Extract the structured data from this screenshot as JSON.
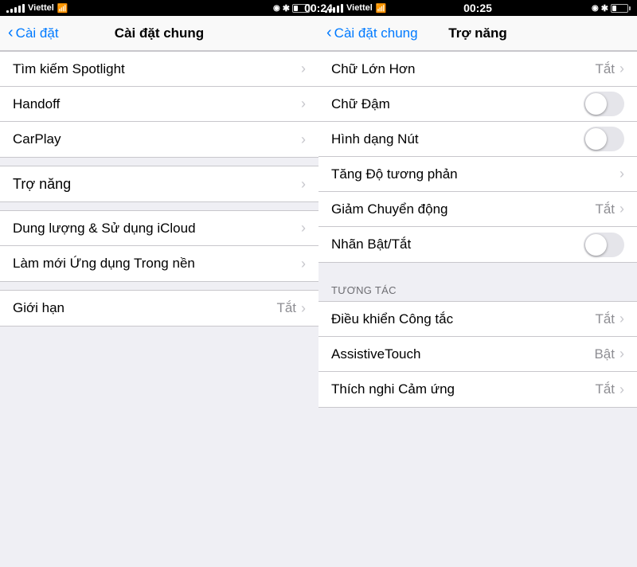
{
  "panel_left": {
    "status": {
      "carrier": "Viettel",
      "time": "00:24",
      "battery_pct": 30
    },
    "nav": {
      "back_label": "Cài đặt",
      "title": "Cài đặt chung"
    },
    "items": [
      {
        "label": "Tìm kiếm Spotlight",
        "value": "",
        "type": "chevron"
      },
      {
        "label": "Handoff",
        "value": "",
        "type": "chevron"
      },
      {
        "label": "CarPlay",
        "value": "",
        "type": "chevron"
      },
      {
        "label": "Trợ năng",
        "value": "",
        "type": "chevron",
        "highlighted": true
      },
      {
        "label": "Dung lượng & Sử dụng iCloud",
        "value": "",
        "type": "chevron"
      },
      {
        "label": "Làm mới Ứng dụng Trong nền",
        "value": "",
        "type": "chevron"
      },
      {
        "label": "Giới hạn",
        "value": "Tắt",
        "type": "chevron"
      }
    ]
  },
  "panel_right": {
    "status": {
      "carrier": "Viettel",
      "time": "00:25",
      "battery_pct": 30
    },
    "nav": {
      "back_label": "Cài đặt chung",
      "title": "Trợ năng"
    },
    "items_top": [
      {
        "label": "Chữ Lớn Hơn",
        "value": "Tắt",
        "type": "chevron"
      },
      {
        "label": "Chữ Đậm",
        "value": "",
        "type": "toggle",
        "toggle_state": "off"
      },
      {
        "label": "Hình dạng Nút",
        "value": "",
        "type": "toggle",
        "toggle_state": "off"
      },
      {
        "label": "Tăng Độ tương phản",
        "value": "",
        "type": "chevron"
      },
      {
        "label": "Giảm Chuyển động",
        "value": "Tắt",
        "type": "chevron",
        "highlighted": true
      },
      {
        "label": "Nhãn Bật/Tắt",
        "value": "",
        "type": "toggle",
        "toggle_state": "off"
      }
    ],
    "section_label": "TƯƠNG TÁC",
    "items_bottom": [
      {
        "label": "Điều khiển Công tắc",
        "value": "Tắt",
        "type": "chevron"
      },
      {
        "label": "AssistiveTouch",
        "value": "Bật",
        "type": "chevron"
      },
      {
        "label": "Thích nghi Cảm ứng",
        "value": "Tắt",
        "type": "chevron"
      }
    ]
  }
}
